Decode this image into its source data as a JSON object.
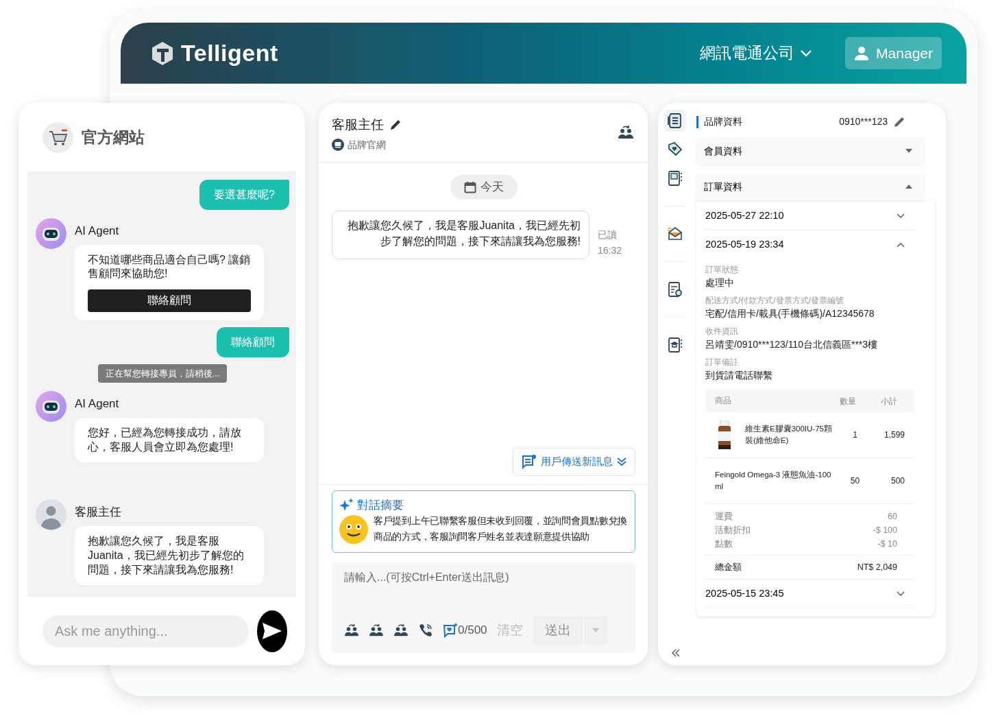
{
  "header": {
    "logo": "Telligent",
    "company": "網訊電通公司",
    "user": "Manager"
  },
  "widget": {
    "title": "官方網站",
    "messages": [
      {
        "kind": "user",
        "text": "要選甚麼呢?"
      },
      {
        "kind": "bot",
        "sender": "AI Agent",
        "text": "不知道哪些商品適合自己嗎? 讓銷售顧問來協助您!",
        "button": "聯絡顧問"
      },
      {
        "kind": "user",
        "text": "聯絡顧問"
      },
      {
        "kind": "system",
        "text": "正在幫您轉接專員，請稍後..."
      },
      {
        "kind": "bot",
        "sender": "AI Agent",
        "text": "您好，已經為您轉接成功，請放心，客服人員會立即為您處理!"
      },
      {
        "kind": "agent",
        "sender": "客服主任",
        "text": "抱歉讓您久候了，我是客服Juanita，我已經先初步了解您的問題，接下來請讓我為您服務!"
      }
    ],
    "input_placeholder": "Ask me anything..."
  },
  "conversation": {
    "title": "客服主任",
    "channel": "品牌官網",
    "date": "今天",
    "messages": [
      {
        "text": "抱歉讓您久候了，我是客服Juanita，我已經先初步了解您的問題，接下來請讓我為您服務!",
        "status": "已讀",
        "time": "16:32"
      }
    ],
    "new_message_button": "用戶傳送新訊息",
    "summary": {
      "title": "對話摘要",
      "text": "客戶提到上午已聯繫客服但未收到回覆，並詢問會員點數兌換商品的方式，客服詢問客戶姓名並表達願意提供協助"
    },
    "composer": {
      "placeholder": "請輸入...(可按Ctrl+Enter送出訊息)",
      "count": "0/500",
      "clear": {
        "label": "清空",
        "disabled": true
      },
      "send": {
        "label": "送出",
        "disabled": true
      }
    }
  },
  "sidebar": {
    "items": [
      {
        "selected": true
      },
      {
        "selected": false
      },
      {
        "selected": false
      },
      {
        "selected": false
      },
      {
        "selected": false
      },
      {
        "selected": false
      }
    ]
  },
  "customer": {
    "section": "品牌資料",
    "phone": "0910***123",
    "accordions": [
      {
        "title": "會員資料",
        "expanded": false
      },
      {
        "title": "訂單資料",
        "expanded": true
      }
    ],
    "orders": [
      {
        "datetime": "2025-05-27 22:10",
        "expanded": false
      },
      {
        "datetime": "2025-05-19 23:34",
        "expanded": true,
        "fields": [
          {
            "label": "訂單狀態",
            "value": "處理中"
          },
          {
            "label": "配送方式/付款方式/發票方式/發票編號",
            "value": "宅配/信用卡/載具(手機條碼)/A12345678"
          },
          {
            "label": "收件資訊",
            "value": "呂靖雯/0910***123/110台北信義區***3樓"
          },
          {
            "label": "訂單備註",
            "value": "到貨請電話聯繫"
          }
        ],
        "columns": [
          "商品",
          "數量",
          "小計"
        ],
        "items": [
          {
            "name": "維生素E膠囊300IU-75顆裝(維他命E)",
            "qty": "1",
            "subtotal": "1,599",
            "image": true
          },
          {
            "name": "Feingold Omega-3 液態魚油-100 ml",
            "qty": "50",
            "subtotal": "500",
            "image": false
          }
        ],
        "fees": [
          {
            "label": "運費",
            "value": "60"
          },
          {
            "label": "活動折扣",
            "value": "-$ 100"
          },
          {
            "label": "點數",
            "value": "-$ 10"
          }
        ],
        "total": {
          "label": "總金額",
          "value": "NT$ 2,049"
        }
      },
      {
        "datetime": "2025-05-15 23:45",
        "expanded": false
      }
    ]
  }
}
